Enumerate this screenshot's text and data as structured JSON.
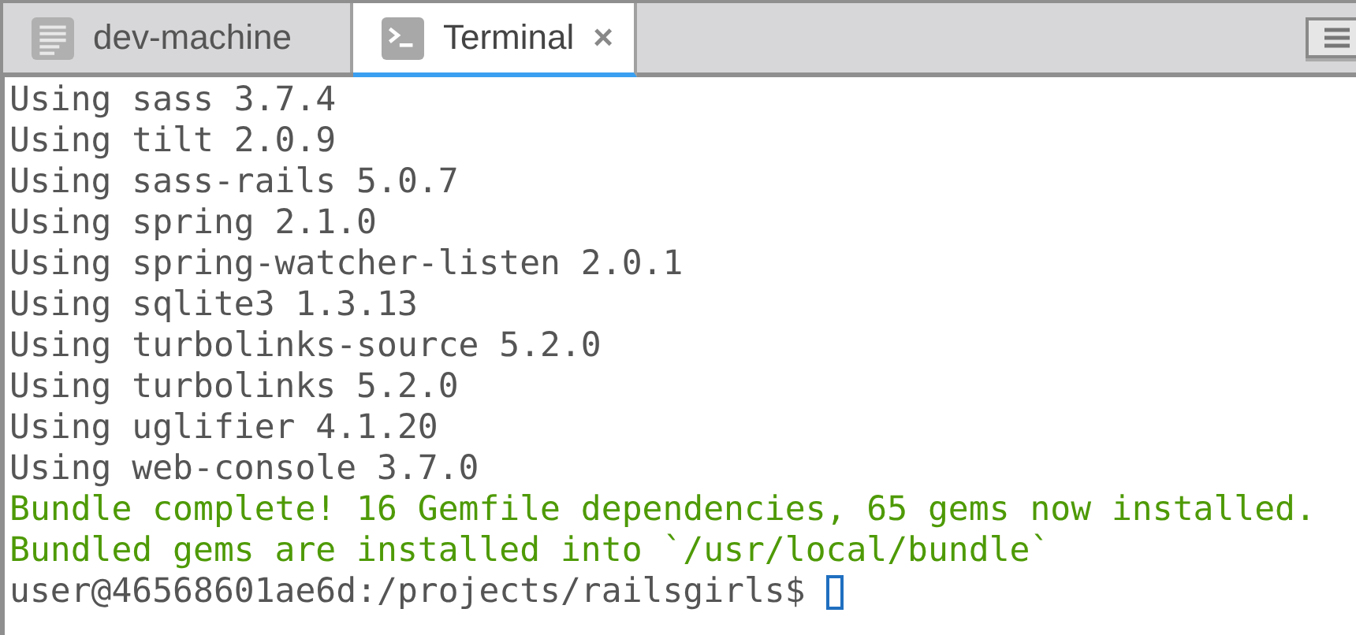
{
  "tabs": [
    {
      "label": "dev-machine",
      "kind": "document",
      "selected": false
    },
    {
      "label": "Terminal",
      "kind": "terminal",
      "selected": true,
      "close_glyph": "×"
    }
  ],
  "terminal": {
    "lines": [
      {
        "kind": "output",
        "text": "Using sass 3.7.4"
      },
      {
        "kind": "output",
        "text": "Using tilt 2.0.9"
      },
      {
        "kind": "output",
        "text": "Using sass-rails 5.0.7"
      },
      {
        "kind": "output",
        "text": "Using spring 2.1.0"
      },
      {
        "kind": "output",
        "text": "Using spring-watcher-listen 2.0.1"
      },
      {
        "kind": "output",
        "text": "Using sqlite3 1.3.13"
      },
      {
        "kind": "output",
        "text": "Using turbolinks-source 5.2.0"
      },
      {
        "kind": "output",
        "text": "Using turbolinks 5.2.0"
      },
      {
        "kind": "output",
        "text": "Using uglifier 4.1.20"
      },
      {
        "kind": "output",
        "text": "Using web-console 3.7.0"
      },
      {
        "kind": "success",
        "text": "Bundle complete! 16 Gemfile dependencies, 65 gems now installed."
      },
      {
        "kind": "success",
        "text": "Bundled gems are installed into `/usr/local/bundle`"
      }
    ],
    "prompt": "user@46568601ae6d:/projects/railsgirls$"
  }
}
